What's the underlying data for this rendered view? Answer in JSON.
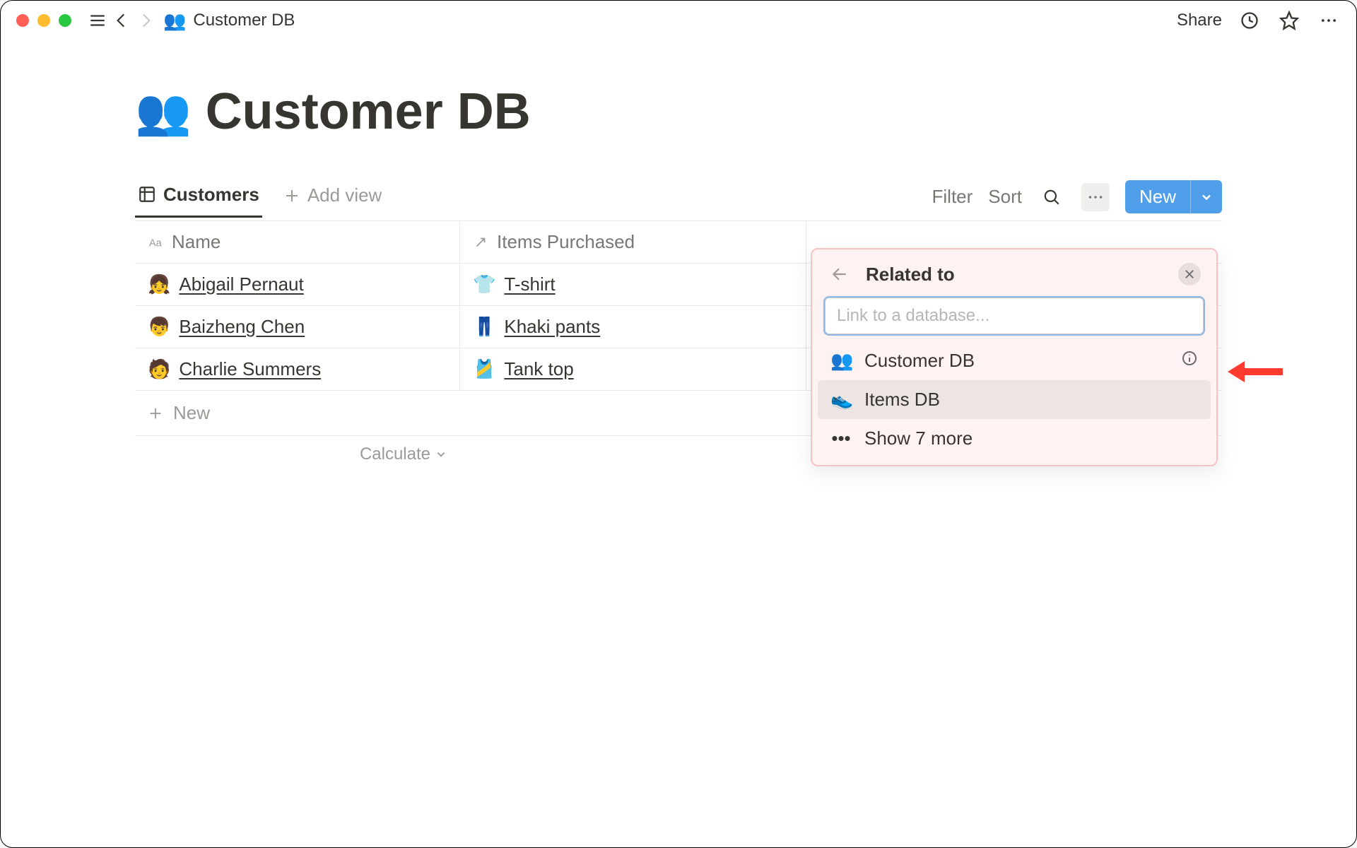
{
  "breadcrumb": {
    "icon": "👥",
    "title": "Customer DB"
  },
  "topbar": {
    "share": "Share"
  },
  "page": {
    "icon": "👥",
    "title": "Customer DB"
  },
  "tabs": {
    "active": "Customers",
    "add": "Add view"
  },
  "controls": {
    "filter": "Filter",
    "sort": "Sort",
    "new": "New"
  },
  "columns": {
    "name": "Name",
    "items": "Items Purchased"
  },
  "rows": [
    {
      "avatar": "👧",
      "name": "Abigail Pernaut",
      "item_emoji": "👕",
      "item": "T-shirt"
    },
    {
      "avatar": "👦",
      "name": "Baizheng Chen",
      "item_emoji": "👖",
      "item": "Khaki pants"
    },
    {
      "avatar": "🧑",
      "name": "Charlie Summers",
      "item_emoji": "🎽",
      "item": "Tank top"
    }
  ],
  "newrow": "New",
  "calculate": "Calculate",
  "popup": {
    "title": "Related to",
    "placeholder": "Link to a database...",
    "options": [
      {
        "emoji": "👥",
        "label": "Customer DB",
        "info": true
      },
      {
        "emoji": "👟",
        "label": "Items DB",
        "hover": true
      }
    ],
    "more": "Show 7 more"
  }
}
